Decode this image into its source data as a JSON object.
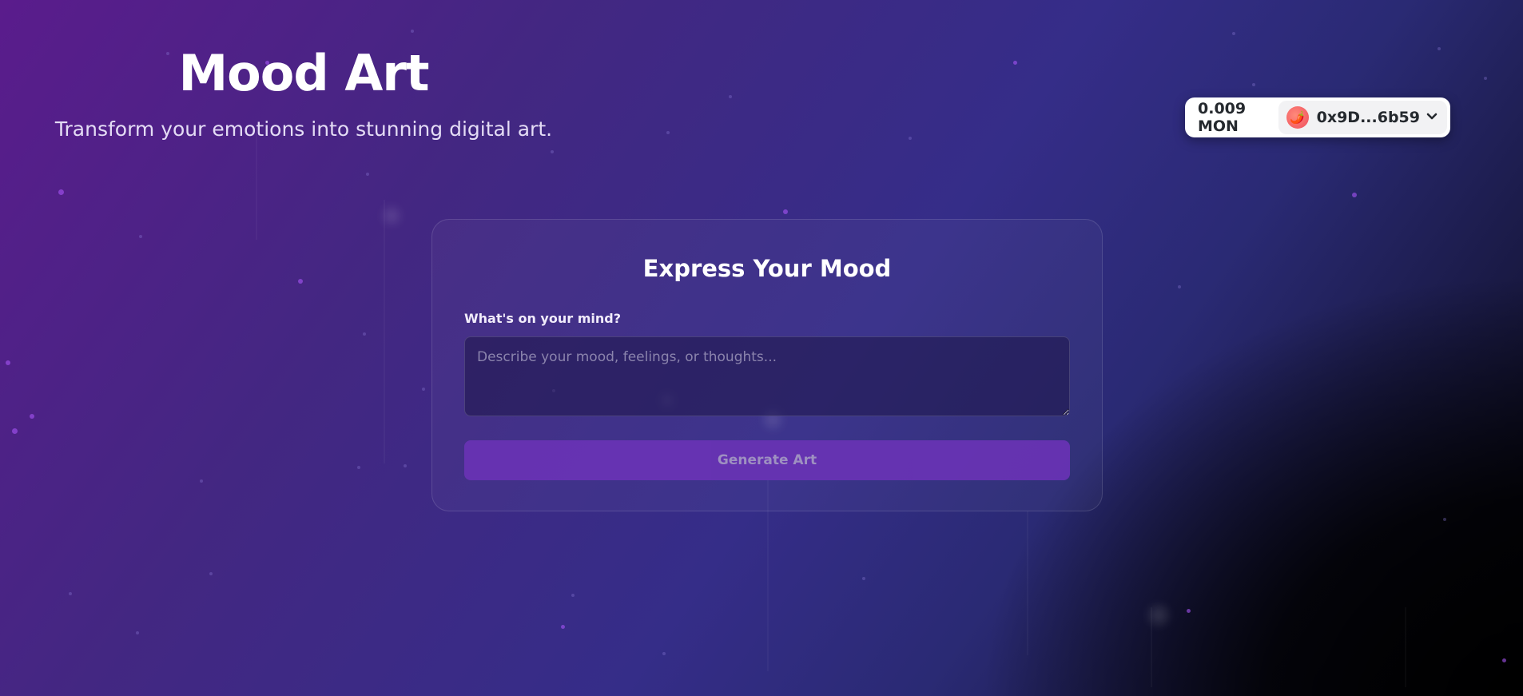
{
  "hero": {
    "title": "Mood Art",
    "subtitle": "Transform your emotions into stunning digital art."
  },
  "wallet": {
    "balance": "0.009 MON",
    "address": "0x9D...6b59",
    "avatar_icon": "🌶️",
    "chevron_icon": "chevron-down-icon"
  },
  "form": {
    "heading": "Express Your Mood",
    "label": "What's on your mind?",
    "placeholder": "Describe your mood, feelings, or thoughts...",
    "value": "",
    "submit_label": "Generate Art"
  },
  "colors": {
    "accent": "#6a33b6",
    "particle": "#a855f7",
    "background_start": "#5a1c8c",
    "background_end": "#050510"
  }
}
